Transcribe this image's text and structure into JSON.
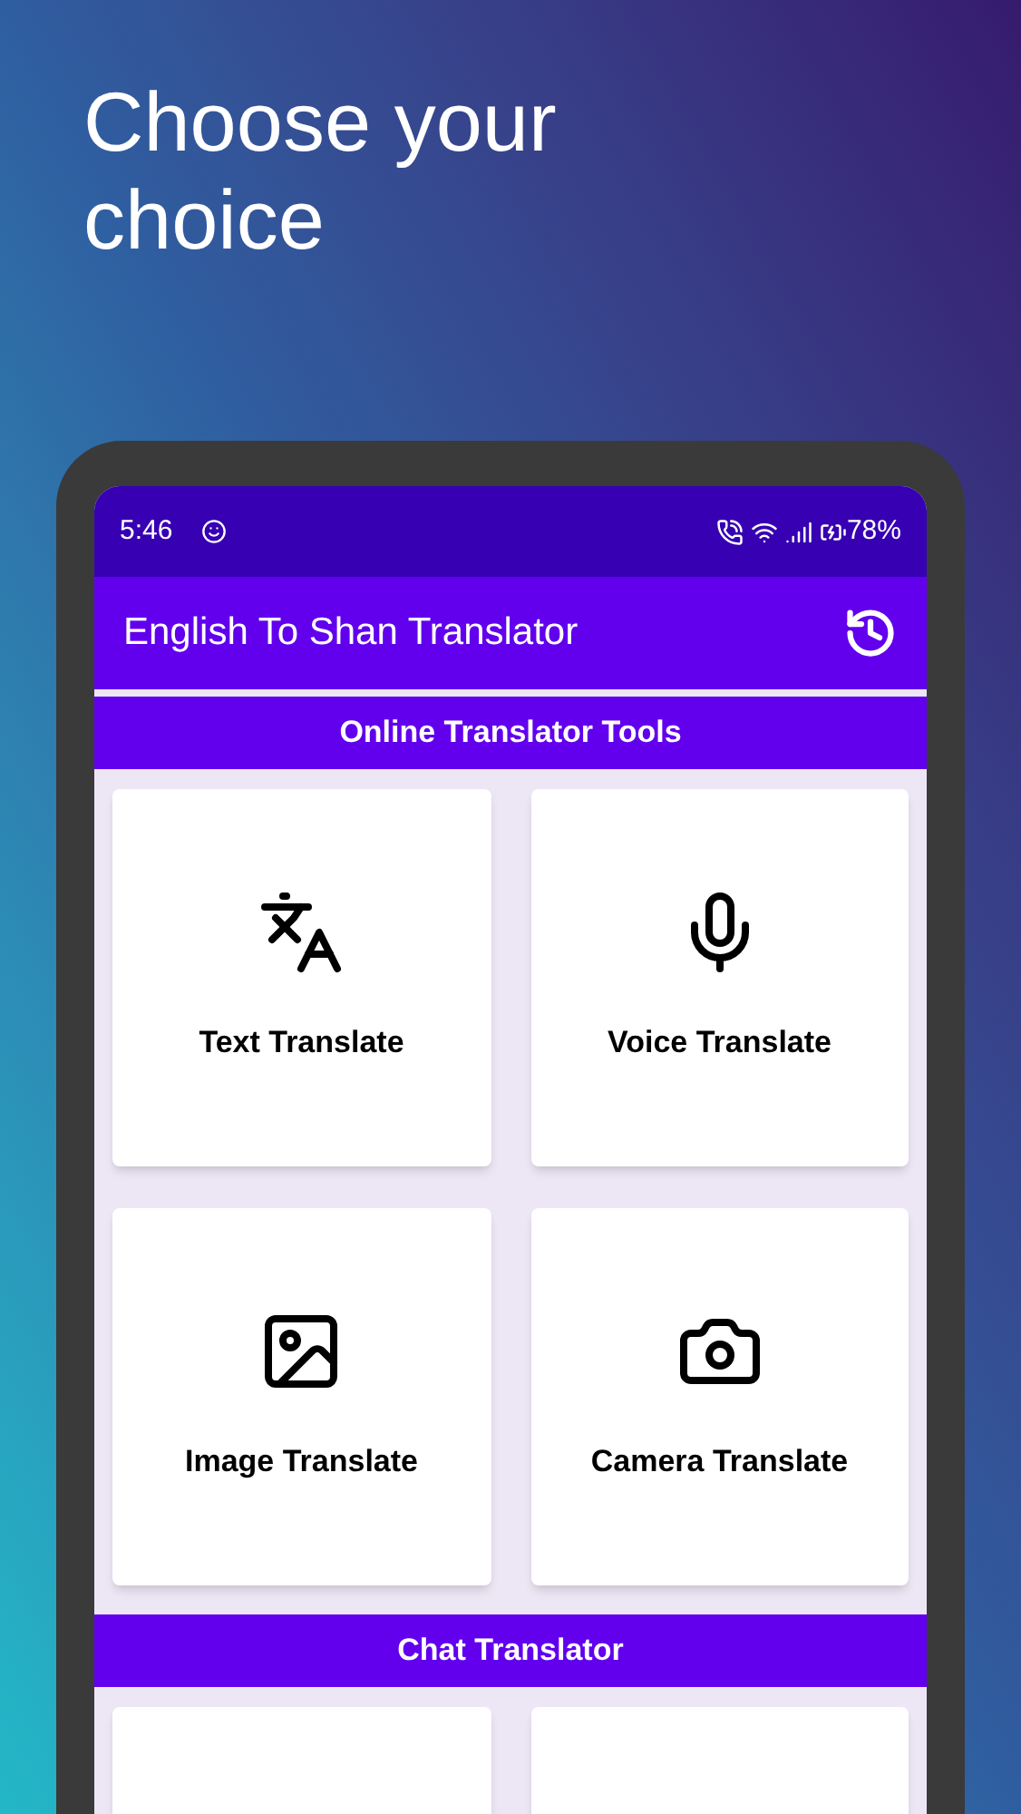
{
  "headline": "Choose your choice",
  "status_bar": {
    "time": "5:46",
    "battery": "78%"
  },
  "app_bar": {
    "title": "English To Shan Translator"
  },
  "sections": [
    {
      "title": "Online Translator Tools",
      "tools": [
        {
          "kind": "text",
          "label": "Text Translate"
        },
        {
          "kind": "voice",
          "label": "Voice Translate"
        },
        {
          "kind": "image",
          "label": "Image Translate"
        },
        {
          "kind": "camera",
          "label": "Camera Translate"
        }
      ]
    },
    {
      "title": "Chat Translator",
      "tools": [
        {
          "kind": "blank"
        },
        {
          "kind": "blank"
        }
      ]
    }
  ]
}
